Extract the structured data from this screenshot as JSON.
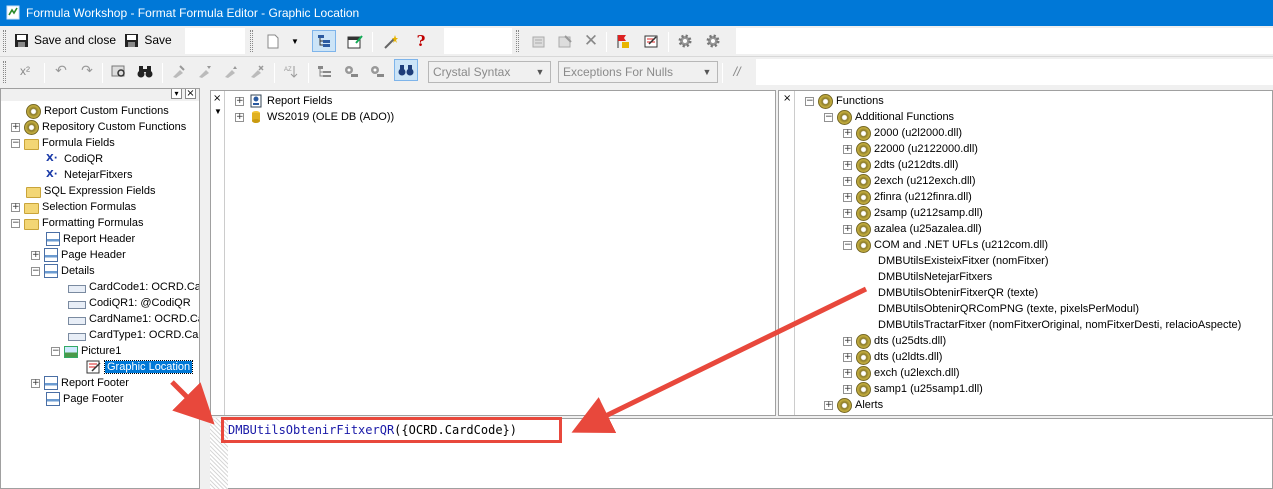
{
  "window": {
    "title": "Formula Workshop - Format Formula Editor - Graphic Location"
  },
  "toolbar1": {
    "save_close_label": "Save and close",
    "save_label": "Save",
    "help_glyph": "?"
  },
  "toolbar2": {
    "superscript_glyph": "x²",
    "syntax_select": "Crystal Syntax",
    "nulls_select": "Exceptions For Nulls",
    "comment_glyph": "//"
  },
  "left_tree": {
    "header_glyphs": [
      "▾",
      "×"
    ],
    "items": [
      {
        "label": "Report Custom Functions",
        "expander": "",
        "icon": "gear-icon"
      },
      {
        "label": "Repository Custom Functions",
        "expander": "+",
        "icon": "gear-icon"
      },
      {
        "label": "Formula Fields",
        "expander": "−",
        "icon": "folder-icon"
      },
      {
        "label": "CodiQR",
        "expander": "",
        "icon": "formula-icon"
      },
      {
        "label": "NetejarFitxers",
        "expander": "",
        "icon": "formula-icon"
      },
      {
        "label": "SQL Expression Fields",
        "expander": "",
        "icon": "folder-icon"
      },
      {
        "label": "Selection Formulas",
        "expander": "+",
        "icon": "folder-icon"
      },
      {
        "label": "Formatting Formulas",
        "expander": "−",
        "icon": "folder-icon"
      },
      {
        "label": "Report Header",
        "expander": "",
        "icon": "section-icon"
      },
      {
        "label": "Page Header",
        "expander": "+",
        "icon": "section-icon"
      },
      {
        "label": "Details",
        "expander": "−",
        "icon": "section-icon"
      },
      {
        "label": "CardCode1: OCRD.Ca",
        "expander": "",
        "icon": "field-icon"
      },
      {
        "label": "CodiQR1: @CodiQR",
        "expander": "",
        "icon": "field-icon"
      },
      {
        "label": "CardName1: OCRD.Ca",
        "expander": "",
        "icon": "field-icon"
      },
      {
        "label": "CardType1: OCRD.Ca",
        "expander": "",
        "icon": "field-icon"
      },
      {
        "label": "Picture1",
        "expander": "−",
        "icon": "picture-icon"
      },
      {
        "label": "Graphic Location",
        "expander": "",
        "icon": "formula-edit-icon",
        "selected": true
      },
      {
        "label": "Report Footer",
        "expander": "+",
        "icon": "section-icon"
      },
      {
        "label": "Page Footer",
        "expander": "",
        "icon": "section-icon"
      }
    ]
  },
  "fields_tree": {
    "items": [
      {
        "label": "Report Fields",
        "expander": "+",
        "icon": "report-fields-icon"
      },
      {
        "label": "WS2019 (OLE DB (ADO))",
        "expander": "+",
        "icon": "database-icon"
      }
    ]
  },
  "functions_tree": {
    "close_glyph": "×",
    "items": [
      {
        "label": "Functions",
        "expander": "−",
        "icon": "gear-icon"
      },
      {
        "label": "Additional Functions",
        "expander": "−",
        "icon": "gear-icon"
      },
      {
        "label": "2000 (u2l2000.dll)",
        "expander": "+",
        "icon": "gear-icon"
      },
      {
        "label": "22000 (u2122000.dll)",
        "expander": "+",
        "icon": "gear-icon"
      },
      {
        "label": "2dts (u212dts.dll)",
        "expander": "+",
        "icon": "gear-icon"
      },
      {
        "label": "2exch (u212exch.dll)",
        "expander": "+",
        "icon": "gear-icon"
      },
      {
        "label": "2finra (u212finra.dll)",
        "expander": "+",
        "icon": "gear-icon"
      },
      {
        "label": "2samp (u212samp.dll)",
        "expander": "+",
        "icon": "gear-icon"
      },
      {
        "label": "azalea (u25azalea.dll)",
        "expander": "+",
        "icon": "gear-icon"
      },
      {
        "label": "COM and .NET UFLs (u212com.dll)",
        "expander": "−",
        "icon": "gear-icon"
      },
      {
        "label": "DMBUtilsExisteixFitxer (nomFitxer)",
        "expander": "",
        "icon": ""
      },
      {
        "label": "DMBUtilsNetejarFitxers",
        "expander": "",
        "icon": ""
      },
      {
        "label": "DMBUtilsObtenirFitxerQR (texte)",
        "expander": "",
        "icon": ""
      },
      {
        "label": "DMBUtilsObtenirQRComPNG (texte, pixelsPerModul)",
        "expander": "",
        "icon": ""
      },
      {
        "label": "DMBUtilsTractarFitxer (nomFitxerOriginal, nomFitxerDesti, relacioAspecte)",
        "expander": "",
        "icon": ""
      },
      {
        "label": "dts (u25dts.dll)",
        "expander": "+",
        "icon": "gear-icon"
      },
      {
        "label": "dts (u2ldts.dll)",
        "expander": "+",
        "icon": "gear-icon"
      },
      {
        "label": "exch (u2lexch.dll)",
        "expander": "+",
        "icon": "gear-icon"
      },
      {
        "label": "samp1 (u25samp1.dll)",
        "expander": "+",
        "icon": "gear-icon"
      },
      {
        "label": "Alerts",
        "expander": "+",
        "icon": "gear-icon"
      }
    ]
  },
  "editor": {
    "function_name": "DMBUtilsObtenirFitxerQR",
    "arguments": "({OCRD.CardCode})"
  },
  "annotation_color": "#e8483c"
}
